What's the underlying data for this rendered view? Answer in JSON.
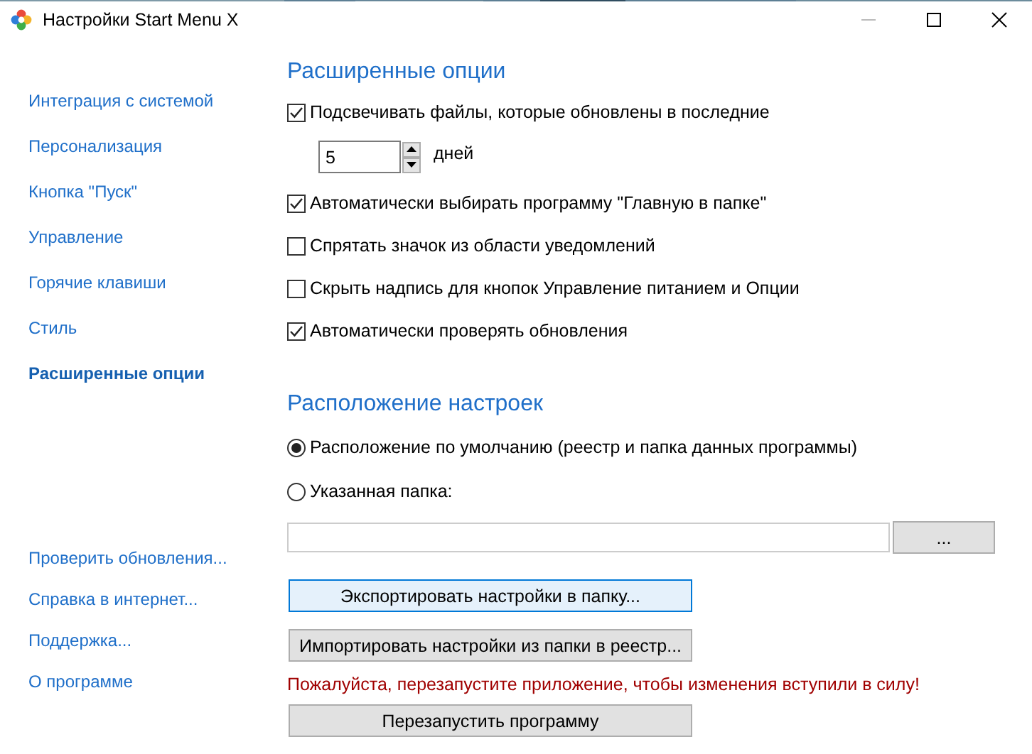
{
  "window": {
    "title": "Настройки Start Menu X"
  },
  "sidebar": {
    "items": [
      {
        "label": "Интеграция с системой",
        "selected": false
      },
      {
        "label": "Персонализация",
        "selected": false
      },
      {
        "label": "Кнопка \"Пуск\"",
        "selected": false
      },
      {
        "label": "Управление",
        "selected": false
      },
      {
        "label": "Горячие клавиши",
        "selected": false
      },
      {
        "label": "Стиль",
        "selected": false
      },
      {
        "label": "Расширенные опции",
        "selected": true
      }
    ],
    "links": [
      {
        "label": "Проверить обновления..."
      },
      {
        "label": "Справка в интернет..."
      },
      {
        "label": "Поддержка..."
      },
      {
        "label": "О программе"
      }
    ]
  },
  "advanced": {
    "heading": "Расширенные опции",
    "options": [
      {
        "kind": "checkbox",
        "label": "Подсвечивать файлы, которые обновлены в последние",
        "checked": true
      },
      {
        "kind": "spinner",
        "value": "5",
        "unit": "дней"
      },
      {
        "kind": "checkbox",
        "label": "Автоматически выбирать программу \"Главную в папке\"",
        "checked": true
      },
      {
        "kind": "checkbox",
        "label": "Спрятать значок из области уведомлений",
        "checked": false
      },
      {
        "kind": "checkbox",
        "label": "Скрыть надпись для кнопок Управление питанием и Опции",
        "checked": false
      },
      {
        "kind": "checkbox",
        "label": "Автоматически проверять обновления",
        "checked": true
      }
    ]
  },
  "location": {
    "heading": "Расположение настроек",
    "radios": [
      {
        "label": "Расположение по умолчанию (реестр и папка данных программы)",
        "selected": true
      },
      {
        "label": "Указанная папка:",
        "selected": false
      }
    ],
    "browse_button": "..."
  },
  "actions": {
    "buttons": [
      {
        "label": "Экспортировать настройки в папку...",
        "focused": true
      },
      {
        "label": "Импортировать настройки из папки в реестр...",
        "focused": false
      }
    ],
    "notice": "Пожалуйста, перезапустите приложение, чтобы изменения вступили в силу!",
    "restart_button": "Перезапустить программу"
  }
}
